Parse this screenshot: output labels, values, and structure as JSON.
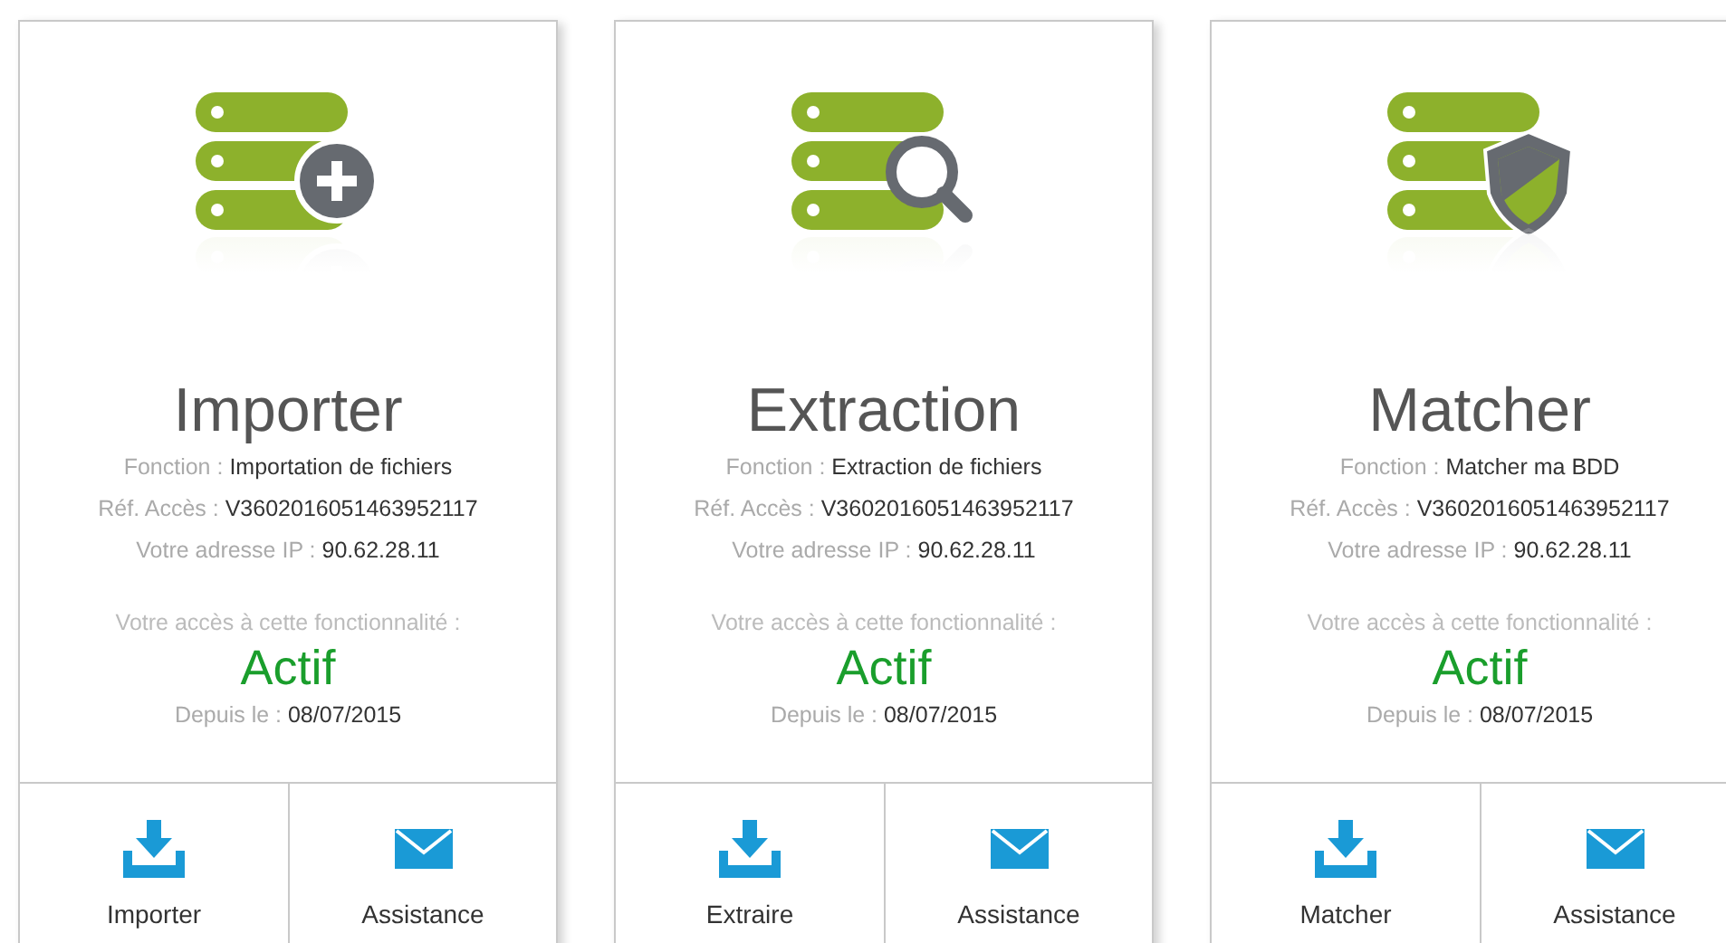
{
  "cards": [
    {
      "kind": "add",
      "title": "Importer",
      "details": [
        {
          "label": "Fonction :",
          "value": "Importation de fichiers"
        },
        {
          "label": "Réf. Accès :",
          "value": "V3602016051463952117"
        },
        {
          "label": "Votre adresse IP :",
          "value": "90.62.28.11"
        }
      ],
      "access_label": "Votre accès à cette fonctionnalité :",
      "status": "Actif",
      "active": true,
      "since_label": "Depuis le :",
      "since": "08/07/2015",
      "actions": [
        {
          "kind": "download",
          "label": "Importer"
        },
        {
          "kind": "mail",
          "label": "Assistance"
        }
      ]
    },
    {
      "kind": "search",
      "title": "Extraction",
      "details": [
        {
          "label": "Fonction :",
          "value": "Extraction de fichiers"
        },
        {
          "label": "Réf. Accès :",
          "value": "V3602016051463952117"
        },
        {
          "label": "Votre adresse IP :",
          "value": "90.62.28.11"
        }
      ],
      "access_label": "Votre accès à cette fonctionnalité :",
      "status": "Actif",
      "active": true,
      "since_label": "Depuis le :",
      "since": "08/07/2015",
      "actions": [
        {
          "kind": "download",
          "label": "Extraire"
        },
        {
          "kind": "mail",
          "label": "Assistance"
        }
      ]
    },
    {
      "kind": "shield",
      "title": "Matcher",
      "details": [
        {
          "label": "Fonction :",
          "value": "Matcher ma BDD"
        },
        {
          "label": "Réf. Accès :",
          "value": "V3602016051463952117"
        },
        {
          "label": "Votre adresse IP :",
          "value": "90.62.28.11"
        }
      ],
      "access_label": "Votre accès à cette fonctionnalité :",
      "status": "Actif",
      "active": true,
      "since_label": "Depuis le :",
      "since": "08/07/2015",
      "actions": [
        {
          "kind": "download",
          "label": "Matcher"
        },
        {
          "kind": "mail",
          "label": "Assistance"
        }
      ]
    }
  ]
}
